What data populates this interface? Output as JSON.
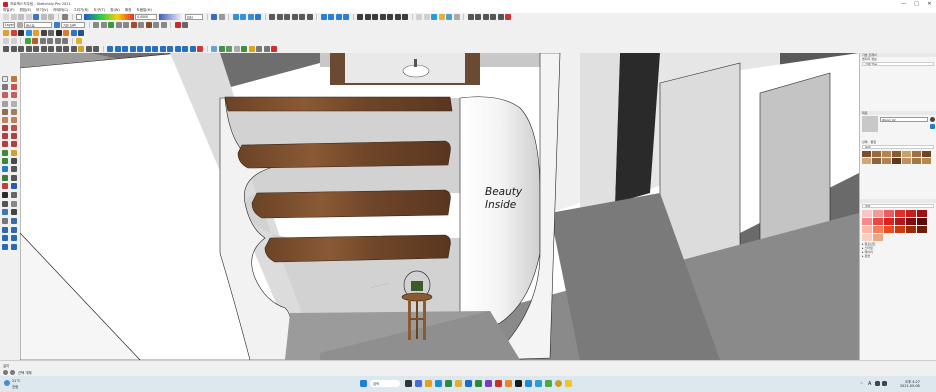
{
  "app": {
    "title": "프로젝ㅌ지우팀 - SketchUp Pro 2021",
    "window_controls": [
      "—",
      "□",
      "✕"
    ]
  },
  "menu": [
    "파일(F)",
    "편집(E)",
    "보기(V)",
    "카메라(C)",
    "그리기(R)",
    "도구(T)",
    "창(W)",
    "확장",
    "도움말(H)"
  ],
  "toolbar": {
    "layer_combo": "Layer0",
    "scene_combo": "테스트",
    "style_combo": "기본 장면",
    "unit_combo": "미터",
    "edge_label": "0.0000"
  },
  "viewport": {
    "wall_text_line1": "Beauty",
    "wall_text_line2": "Inside"
  },
  "right_panel": {
    "tray_header": "기본 트레이",
    "entity_info_header": "엔티티 정보",
    "entity_info_value": "선택 없음",
    "materials_header": "재료",
    "material_name": "Wood_02",
    "tab_select": "선택",
    "tab_edit": "편집",
    "wood_dropdown": "목재",
    "colors_dropdown": "색상",
    "sections": [
      "▸ 컴포넌트",
      "▸ 스타일",
      "▸ 레이어",
      "▸ 장면"
    ],
    "wood_colors": [
      "#7a4e2c",
      "#9a6a3c",
      "#b7834d",
      "#8b5a33",
      "#c9a06a",
      "#a0703f",
      "#6e4528",
      "#d0a67a",
      "#8a6440",
      "#b08254",
      "#5c3a22",
      "#c09060",
      "#9c7a4e",
      "#b4884e"
    ],
    "red_colors": [
      "#f6c7c7",
      "#f19a9a",
      "#e85f5f",
      "#e02d2d",
      "#c81d1d",
      "#9d1111",
      "#f58a8a",
      "#ef4444",
      "#d92222",
      "#b31818",
      "#7d0d0d",
      "#5a0808",
      "#f9b9a4",
      "#f57d5a",
      "#ec4b1e",
      "#cc3b10",
      "#9a2b0a",
      "#6a1d07",
      "#f6d0c0",
      "#e9a888"
    ]
  },
  "status": {
    "measure_label": "길이",
    "hint": "선택 개체"
  },
  "taskbar": {
    "weather": "21°C",
    "weather_sub": "흐림",
    "search": "검색",
    "lang": "A",
    "time": "오후 4:27",
    "date": "2021-05-08"
  }
}
